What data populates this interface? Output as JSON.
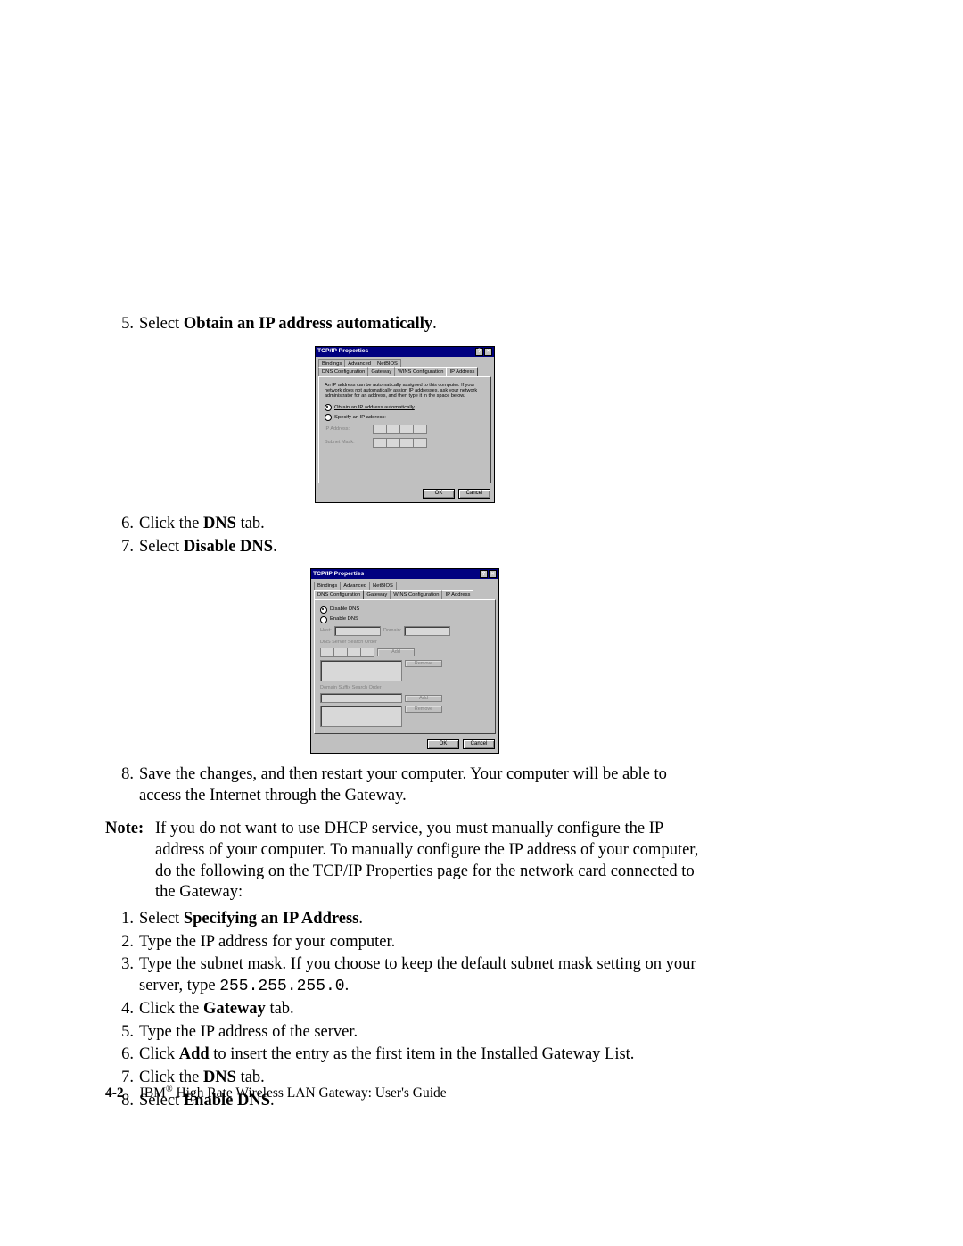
{
  "step5": {
    "prefix": "5.",
    "text_before": "Select ",
    "bold": "Obtain an IP address automatically",
    "text_after": "."
  },
  "step6": {
    "prefix": "6.",
    "text_before": "Click the ",
    "bold": "DNS",
    "text_after": " tab."
  },
  "step7": {
    "prefix": "7.",
    "text_before": "Select ",
    "bold": "Disable DNS",
    "text_after": "."
  },
  "step8": {
    "prefix": "8.",
    "text": "Save the changes, and then restart your computer. Your computer will be able to access the Internet through the Gateway."
  },
  "note": {
    "label": "Note:",
    "text": "If you do not want to use DHCP service, you must manually configure the IP address of your computer. To manually configure the IP address of your computer, do the following on the TCP/IP Properties page for the network card connected to the Gateway:"
  },
  "sub1": {
    "prefix": "1.",
    "text_before": "Select ",
    "bold": "Specifying an IP Address",
    "text_after": "."
  },
  "sub2": {
    "prefix": "2.",
    "text": "Type the IP address for your computer."
  },
  "sub3": {
    "prefix": "3.",
    "text_before": "Type the subnet mask. If you choose to keep the default subnet mask setting on your server, type ",
    "mono": "255.255.255.0",
    "text_after": "."
  },
  "sub4": {
    "prefix": "4.",
    "text_before": "Click the ",
    "bold": "Gateway",
    "text_after": " tab."
  },
  "sub5": {
    "prefix": "5.",
    "text": "Type the IP address of the server."
  },
  "sub6": {
    "prefix": "6.",
    "text_before": "Click ",
    "bold": "Add",
    "text_after": " to insert the entry as the first item in the Installed Gateway List."
  },
  "sub7": {
    "prefix": "7.",
    "text_before": "Click the ",
    "bold": "DNS",
    "text_after": " tab."
  },
  "sub8": {
    "prefix": "8.",
    "text_before": "Select ",
    "bold": "Enable DNS",
    "text_after": "."
  },
  "footer": {
    "page_num": "4-2",
    "brand": "IBM",
    "reg": "®",
    "title": " High Rate Wireless LAN Gateway:  User's Guide"
  },
  "dialog_ip": {
    "title": "TCP/IP Properties",
    "help_btn": "?",
    "close_btn": "×",
    "tabs_row1": [
      "Bindings",
      "Advanced",
      "NetBIOS"
    ],
    "tabs_row2": [
      "DNS Configuration",
      "Gateway",
      "WINS Configuration",
      "IP Address"
    ],
    "help_text": "An IP address can be automatically assigned to this computer. If your network does not automatically assign IP addresses, ask your network administrator for an address, and then type it in the space below.",
    "radio_auto": "Obtain an IP address automatically",
    "radio_manual": "Specify an IP address:",
    "ip_label": "IP Address:",
    "subnet_label": "Subnet Mask:",
    "ok": "OK",
    "cancel": "Cancel"
  },
  "dialog_dns": {
    "title": "TCP/IP Properties",
    "help_btn": "?",
    "close_btn": "×",
    "tabs_row1": [
      "Bindings",
      "Advanced",
      "NetBIOS"
    ],
    "tabs_row2": [
      "DNS Configuration",
      "Gateway",
      "WINS Configuration",
      "IP Address"
    ],
    "radio_disable": "Disable DNS",
    "radio_enable": "Enable DNS",
    "host": "Host:",
    "domain": "Domain:",
    "search_order": "DNS Server Search Order",
    "suffix_order": "Domain Suffix Search Order",
    "add": "Add",
    "remove": "Remove",
    "ok": "OK",
    "cancel": "Cancel"
  }
}
